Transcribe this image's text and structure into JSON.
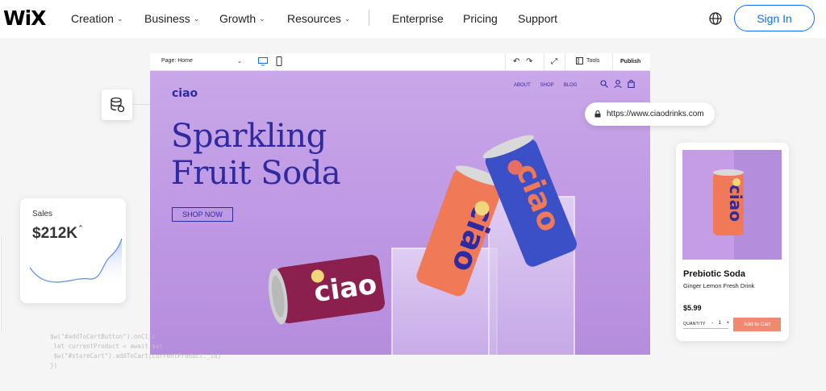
{
  "nav": {
    "logo": "WiX",
    "items": [
      {
        "label": "Creation",
        "dropdown": true
      },
      {
        "label": "Business",
        "dropdown": true
      },
      {
        "label": "Growth",
        "dropdown": true
      },
      {
        "label": "Resources",
        "dropdown": true
      },
      {
        "label": "Enterprise",
        "dropdown": false
      },
      {
        "label": "Pricing",
        "dropdown": false
      },
      {
        "label": "Support",
        "dropdown": false
      }
    ],
    "sign_in": "Sign In",
    "accent": "#116dff"
  },
  "editor": {
    "page_select": "Page: Home",
    "tools": "Tools",
    "publish": "Publish"
  },
  "site": {
    "logo": "ciao",
    "menu": [
      "ABOUT",
      "SHOP",
      "BLOG"
    ],
    "headline_line1": "Sparkling",
    "headline_line2": "Fruit Soda",
    "cta": "SHOP NOW",
    "brand_color": "#2f2aa0",
    "can_text": "ciao"
  },
  "url_bar": {
    "url": "https://www.ciaodrinks.com"
  },
  "sales": {
    "label": "Sales",
    "value": "$212K",
    "trend": "up"
  },
  "product": {
    "name": "Prebiotic Soda",
    "subtitle": "Ginger Lemon Fresh Drink",
    "price": "$5.99",
    "quantity_label": "QUANTITY",
    "quantity": "1",
    "minus": "-",
    "plus": "+",
    "add_to_cart": "Add to Cart",
    "button_color": "#f08a6e"
  },
  "code_lines": [
    "$w(\"#addToCartButton\").onClic",
    " let currentProduct = await $w(",
    " $w(\"#storeCart\").addToCart(currentProduct._id)",
    "})"
  ]
}
